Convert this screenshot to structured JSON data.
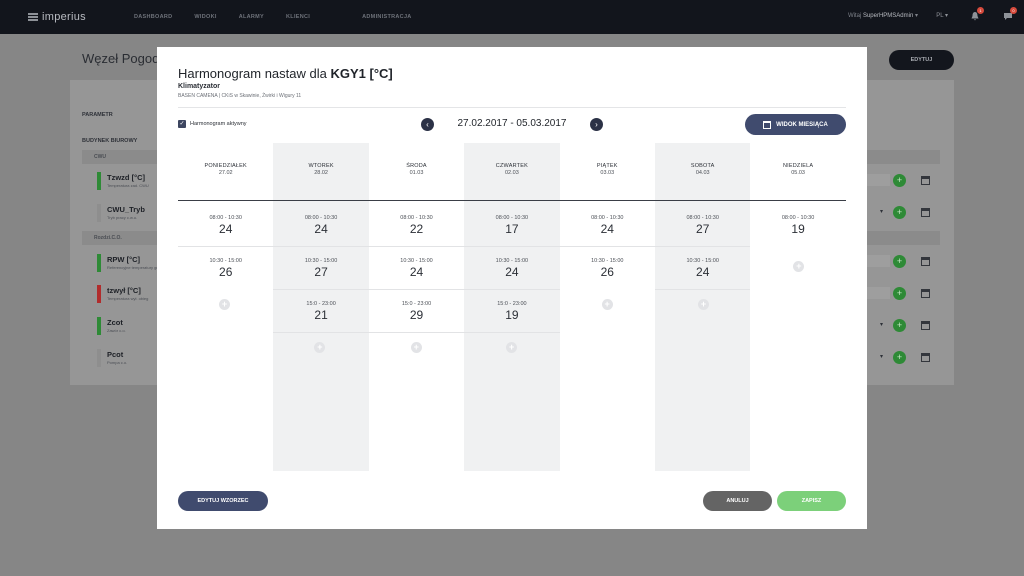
{
  "topbar": {
    "logo": "imperius",
    "nav": [
      "DASHBOARD",
      "WIDOKI",
      "ALARMY",
      "KLIENCI",
      "ADMINISTRACJA"
    ],
    "user_prefix": "Witaj",
    "user_name": "SuperHPMSAdmin",
    "lang": "PL",
    "notif_count": "1",
    "msg_count": "0"
  },
  "background": {
    "page_title": "Węzeł Pogodo",
    "edit_button": "EDYTUJ",
    "param_header": "PARAMETR",
    "building": "BUDYNEK BIUROWY",
    "section_cwu": "CWU",
    "section_co": "Rozdzi.C.O.",
    "params": [
      {
        "name": "Tzwzd [°C]",
        "desc": "Temperatura zad. CWU",
        "color": "#2e8a36"
      },
      {
        "name": "CWU_Tryb",
        "desc": "Tryb pracy c.w.u.",
        "color": "#ffffff"
      },
      {
        "name": "RPW [°C]",
        "desc": "Referencyjne temperatury granicznej",
        "color": "#2e8a36"
      },
      {
        "name": "tzwył [°C]",
        "desc": "Temperatura wył. obieg",
        "color": "#b12c2c"
      },
      {
        "name": "Zcot",
        "desc": "Zawór c.o.",
        "color": "#2e8a36"
      },
      {
        "name": "Pcot",
        "desc": "Pompa c.o.",
        "color": "#ffffff"
      }
    ]
  },
  "modal": {
    "title_prefix": "Harmonogram nastaw dla",
    "title_bold": "KGY1 [°C]",
    "subtitle": "Klimatyzator",
    "location": "BASEN CAMENA  |  CKiS w Skawinie, Żwirki i Wigury 11",
    "active_label": "Harmonogram aktywny",
    "date_range": "27.02.2017 - 05.03.2017",
    "month_view": "WIDOK MIESIĄCA",
    "days": [
      {
        "name": "PONIEDZIAŁEK",
        "date": "27.02",
        "slots": [
          {
            "time": "08:00 - 10:30",
            "value": "24"
          },
          {
            "time": "10:30 - 15:00",
            "value": "26"
          }
        ]
      },
      {
        "name": "WTOREK",
        "date": "28.02",
        "slots": [
          {
            "time": "08:00 - 10:30",
            "value": "24"
          },
          {
            "time": "10:30 - 15:00",
            "value": "27"
          },
          {
            "time": "15:0 - 23:00",
            "value": "21"
          }
        ]
      },
      {
        "name": "ŚRODA",
        "date": "01.03",
        "slots": [
          {
            "time": "08:00 - 10:30",
            "value": "22"
          },
          {
            "time": "10:30 - 15:00",
            "value": "24"
          },
          {
            "time": "15:0 - 23:00",
            "value": "29"
          }
        ]
      },
      {
        "name": "CZWARTEK",
        "date": "02.03",
        "slots": [
          {
            "time": "08:00 - 10:30",
            "value": "17"
          },
          {
            "time": "10:30 - 15:00",
            "value": "24"
          },
          {
            "time": "15:0 - 23:00",
            "value": "19"
          }
        ]
      },
      {
        "name": "PIĄTEK",
        "date": "03.03",
        "slots": [
          {
            "time": "08:00 - 10:30",
            "value": "24"
          },
          {
            "time": "10:30 - 15:00",
            "value": "26"
          }
        ]
      },
      {
        "name": "SOBOTA",
        "date": "04.03",
        "slots": [
          {
            "time": "08:00 - 10:30",
            "value": "27"
          },
          {
            "time": "10:30 - 15:00",
            "value": "24"
          }
        ]
      },
      {
        "name": "NIEDZIELA",
        "date": "05.03",
        "slots": [
          {
            "time": "08:00 - 10:30",
            "value": "19"
          }
        ]
      }
    ],
    "edit_template": "EDYTUJ WZORZEC",
    "cancel": "ANULUJ",
    "save": "ZAPISZ"
  },
  "colors": {
    "accent": "#404b6e",
    "save": "#7cd07a",
    "cancel": "#646464"
  },
  "icons": [
    "logo-icon",
    "bell-icon",
    "chat-icon",
    "checkbox-icon",
    "arrow-left-icon",
    "arrow-right-icon",
    "calendar-icon",
    "plus-icon"
  ]
}
